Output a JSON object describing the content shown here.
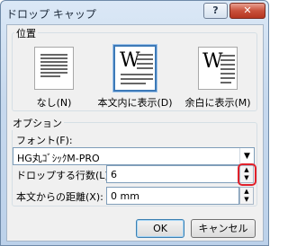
{
  "window": {
    "title": "ドロップ キャップ",
    "help_label": "?",
    "close_label": "✕"
  },
  "position": {
    "group_label": "位置",
    "items": [
      {
        "label": "なし(N)"
      },
      {
        "label": "本文内に表示(D)",
        "selected": true
      },
      {
        "label": "余白に表示(M)"
      }
    ],
    "dropcap_letter": "W"
  },
  "options": {
    "group_label": "オプション",
    "font_label": "フォント(F):",
    "font_value": "HG丸ｺﾞｼｯｸM-PRO",
    "lines_label": "ドロップする行数(L):",
    "lines_value": "6",
    "distance_label": "本文からの距離(X):",
    "distance_value": "0 mm"
  },
  "buttons": {
    "ok": "OK",
    "cancel": "キャンセル"
  }
}
